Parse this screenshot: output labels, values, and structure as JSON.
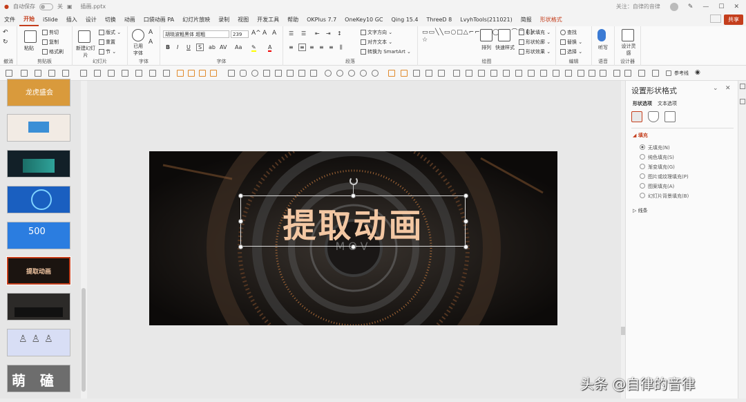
{
  "titlebar": {
    "autosave": "自动保存",
    "toggle_state": "关",
    "filename": "插画.pptx",
    "user": "关注：自律的音律"
  },
  "menu": {
    "file": "文件",
    "tabs": [
      "开始",
      "iSlide",
      "插入",
      "设计",
      "切换",
      "动画",
      "口袋动画 PA",
      "幻灯片放映",
      "录制",
      "视图",
      "开发工具",
      "帮助",
      "OKPlus 7.7",
      "OneKey10 GC",
      "Qing 15.4",
      "ThreeD 8",
      "LvyhTools(211021)",
      "简报",
      "形状格式"
    ],
    "share": "共享"
  },
  "ribbon": {
    "undo_label": "撤消",
    "clipboard": {
      "paste": "粘贴",
      "cut": "剪切",
      "copy": "复制",
      "format_painter": "格式刷",
      "label": "剪贴板"
    },
    "slides": {
      "new_slide": "新建幻灯片",
      "layout": "版式",
      "reset": "重置",
      "section": "节",
      "label": "幻灯片"
    },
    "font_group": {
      "used_fonts": "已用字体",
      "label": "字体"
    },
    "font": {
      "name": "胡晓波粗黑体 超粗",
      "size": "239",
      "label": "字体"
    },
    "paragraph": {
      "text_direction": "文字方向",
      "align_text": "对齐文本",
      "smartart": "转换为 SmartArt",
      "label": "段落"
    },
    "drawing": {
      "arrange": "排列",
      "quick_styles": "快速样式",
      "shape_fill": "形状填充",
      "shape_outline": "形状轮廓",
      "shape_effects": "形状效果",
      "label": "绘图"
    },
    "editing": {
      "find": "查找",
      "replace": "替换",
      "select": "选择",
      "label": "编辑"
    },
    "voice": {
      "dictate": "听写",
      "label": "语音"
    },
    "designer": {
      "design_ideas": "设计灵感",
      "label": "设计器"
    }
  },
  "quickbar": {
    "reference_line": "参考线"
  },
  "thumbnails": [
    {
      "num": "",
      "text": "龙虎盛会",
      "bg": "#d99a3c"
    },
    {
      "num": "",
      "text": "",
      "bg": "#f2ebe4"
    },
    {
      "num": "",
      "text": "",
      "bg": "#122028"
    },
    {
      "num": "",
      "text": "",
      "bg": "#1a5fc0"
    },
    {
      "num": "",
      "text": "500",
      "bg": "#2b7de0"
    },
    {
      "num": "",
      "text": "提取动画",
      "bg": "#1b1410"
    },
    {
      "num": "",
      "text": "",
      "bg": "#2c2a28"
    },
    {
      "num": "",
      "text": "",
      "bg": "#d8def5"
    },
    {
      "num": "",
      "text": "萌   磕",
      "bg": "#6d6d6d"
    }
  ],
  "slide": {
    "title": "提取动画",
    "subtitle": "MOV"
  },
  "format_pane": {
    "title": "设置形状格式",
    "tabs": [
      "形状选项",
      "文本选项"
    ],
    "fill_section": "填充",
    "fill_options": [
      "无填充(N)",
      "纯色填充(S)",
      "渐变填充(G)",
      "图片或纹理填充(P)",
      "图案填充(A)",
      "幻灯片背景填充(B)"
    ],
    "selected_fill": 0,
    "line_section": "线条"
  },
  "watermark": "头条 @自律的音律",
  "colors": {
    "accent": "#c43e1c"
  }
}
